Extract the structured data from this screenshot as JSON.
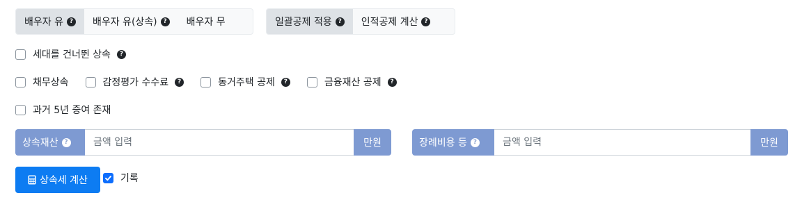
{
  "spouse_group": {
    "options": [
      {
        "label": "배우자 유",
        "help": "?",
        "active": true
      },
      {
        "label": "배우자 유(상속)",
        "help": "?",
        "active": false
      },
      {
        "label": "배우자 무",
        "active": false
      }
    ]
  },
  "deduction_group": {
    "options": [
      {
        "label": "일괄공제 적용",
        "help": "?",
        "active": true
      },
      {
        "label": "인적공제 계산",
        "help": "?",
        "active": false
      }
    ]
  },
  "checkboxes": {
    "generation_skip": {
      "label": "세대를 건너뛴 상속",
      "checked": false,
      "help": "?"
    },
    "debt": {
      "label": "채무상속",
      "checked": false
    },
    "appraisal_fee": {
      "label": "감정평가 수수료",
      "checked": false,
      "help": "?"
    },
    "cohabit_house": {
      "label": "동거주택 공제",
      "checked": false,
      "help": "?"
    },
    "financial_asset": {
      "label": "금융재산 공제",
      "checked": false,
      "help": "?"
    },
    "past_gift": {
      "label": "과거 5년 증여 존재",
      "checked": false
    }
  },
  "inputs": {
    "estate": {
      "label": "상속재산",
      "help": "?",
      "value": "",
      "placeholder": "금액 입력",
      "unit": "만원"
    },
    "funeral": {
      "label": "장례비용 등",
      "help": "?",
      "value": "",
      "placeholder": "금액 입력",
      "unit": "만원"
    }
  },
  "actions": {
    "calculate_label": "상속세 계산",
    "record_label": "기록",
    "record_checked": true
  },
  "colors": {
    "primary": "#0d7cf2",
    "addon": "#7e9ad2",
    "segment_active": "#dee2e6"
  }
}
